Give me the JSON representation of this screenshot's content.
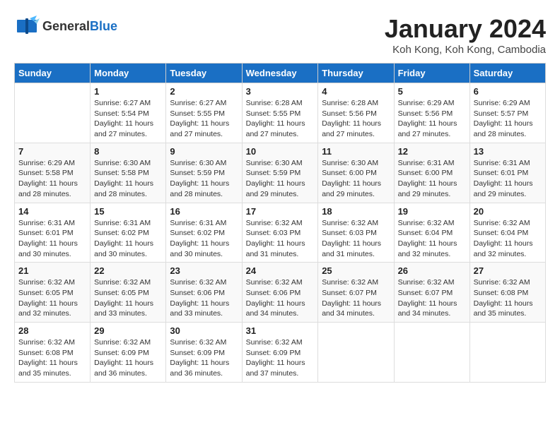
{
  "header": {
    "logo_general": "General",
    "logo_blue": "Blue",
    "month_title": "January 2024",
    "location": "Koh Kong, Koh Kong, Cambodia"
  },
  "days_of_week": [
    "Sunday",
    "Monday",
    "Tuesday",
    "Wednesday",
    "Thursday",
    "Friday",
    "Saturday"
  ],
  "weeks": [
    [
      {
        "day": "",
        "info": ""
      },
      {
        "day": "1",
        "info": "Sunrise: 6:27 AM\nSunset: 5:54 PM\nDaylight: 11 hours\nand 27 minutes."
      },
      {
        "day": "2",
        "info": "Sunrise: 6:27 AM\nSunset: 5:55 PM\nDaylight: 11 hours\nand 27 minutes."
      },
      {
        "day": "3",
        "info": "Sunrise: 6:28 AM\nSunset: 5:55 PM\nDaylight: 11 hours\nand 27 minutes."
      },
      {
        "day": "4",
        "info": "Sunrise: 6:28 AM\nSunset: 5:56 PM\nDaylight: 11 hours\nand 27 minutes."
      },
      {
        "day": "5",
        "info": "Sunrise: 6:29 AM\nSunset: 5:56 PM\nDaylight: 11 hours\nand 27 minutes."
      },
      {
        "day": "6",
        "info": "Sunrise: 6:29 AM\nSunset: 5:57 PM\nDaylight: 11 hours\nand 28 minutes."
      }
    ],
    [
      {
        "day": "7",
        "info": "Sunrise: 6:29 AM\nSunset: 5:58 PM\nDaylight: 11 hours\nand 28 minutes."
      },
      {
        "day": "8",
        "info": "Sunrise: 6:30 AM\nSunset: 5:58 PM\nDaylight: 11 hours\nand 28 minutes."
      },
      {
        "day": "9",
        "info": "Sunrise: 6:30 AM\nSunset: 5:59 PM\nDaylight: 11 hours\nand 28 minutes."
      },
      {
        "day": "10",
        "info": "Sunrise: 6:30 AM\nSunset: 5:59 PM\nDaylight: 11 hours\nand 29 minutes."
      },
      {
        "day": "11",
        "info": "Sunrise: 6:30 AM\nSunset: 6:00 PM\nDaylight: 11 hours\nand 29 minutes."
      },
      {
        "day": "12",
        "info": "Sunrise: 6:31 AM\nSunset: 6:00 PM\nDaylight: 11 hours\nand 29 minutes."
      },
      {
        "day": "13",
        "info": "Sunrise: 6:31 AM\nSunset: 6:01 PM\nDaylight: 11 hours\nand 29 minutes."
      }
    ],
    [
      {
        "day": "14",
        "info": "Sunrise: 6:31 AM\nSunset: 6:01 PM\nDaylight: 11 hours\nand 30 minutes."
      },
      {
        "day": "15",
        "info": "Sunrise: 6:31 AM\nSunset: 6:02 PM\nDaylight: 11 hours\nand 30 minutes."
      },
      {
        "day": "16",
        "info": "Sunrise: 6:31 AM\nSunset: 6:02 PM\nDaylight: 11 hours\nand 30 minutes."
      },
      {
        "day": "17",
        "info": "Sunrise: 6:32 AM\nSunset: 6:03 PM\nDaylight: 11 hours\nand 31 minutes."
      },
      {
        "day": "18",
        "info": "Sunrise: 6:32 AM\nSunset: 6:03 PM\nDaylight: 11 hours\nand 31 minutes."
      },
      {
        "day": "19",
        "info": "Sunrise: 6:32 AM\nSunset: 6:04 PM\nDaylight: 11 hours\nand 32 minutes."
      },
      {
        "day": "20",
        "info": "Sunrise: 6:32 AM\nSunset: 6:04 PM\nDaylight: 11 hours\nand 32 minutes."
      }
    ],
    [
      {
        "day": "21",
        "info": "Sunrise: 6:32 AM\nSunset: 6:05 PM\nDaylight: 11 hours\nand 32 minutes."
      },
      {
        "day": "22",
        "info": "Sunrise: 6:32 AM\nSunset: 6:05 PM\nDaylight: 11 hours\nand 33 minutes."
      },
      {
        "day": "23",
        "info": "Sunrise: 6:32 AM\nSunset: 6:06 PM\nDaylight: 11 hours\nand 33 minutes."
      },
      {
        "day": "24",
        "info": "Sunrise: 6:32 AM\nSunset: 6:06 PM\nDaylight: 11 hours\nand 34 minutes."
      },
      {
        "day": "25",
        "info": "Sunrise: 6:32 AM\nSunset: 6:07 PM\nDaylight: 11 hours\nand 34 minutes."
      },
      {
        "day": "26",
        "info": "Sunrise: 6:32 AM\nSunset: 6:07 PM\nDaylight: 11 hours\nand 34 minutes."
      },
      {
        "day": "27",
        "info": "Sunrise: 6:32 AM\nSunset: 6:08 PM\nDaylight: 11 hours\nand 35 minutes."
      }
    ],
    [
      {
        "day": "28",
        "info": "Sunrise: 6:32 AM\nSunset: 6:08 PM\nDaylight: 11 hours\nand 35 minutes."
      },
      {
        "day": "29",
        "info": "Sunrise: 6:32 AM\nSunset: 6:09 PM\nDaylight: 11 hours\nand 36 minutes."
      },
      {
        "day": "30",
        "info": "Sunrise: 6:32 AM\nSunset: 6:09 PM\nDaylight: 11 hours\nand 36 minutes."
      },
      {
        "day": "31",
        "info": "Sunrise: 6:32 AM\nSunset: 6:09 PM\nDaylight: 11 hours\nand 37 minutes."
      },
      {
        "day": "",
        "info": ""
      },
      {
        "day": "",
        "info": ""
      },
      {
        "day": "",
        "info": ""
      }
    ]
  ]
}
